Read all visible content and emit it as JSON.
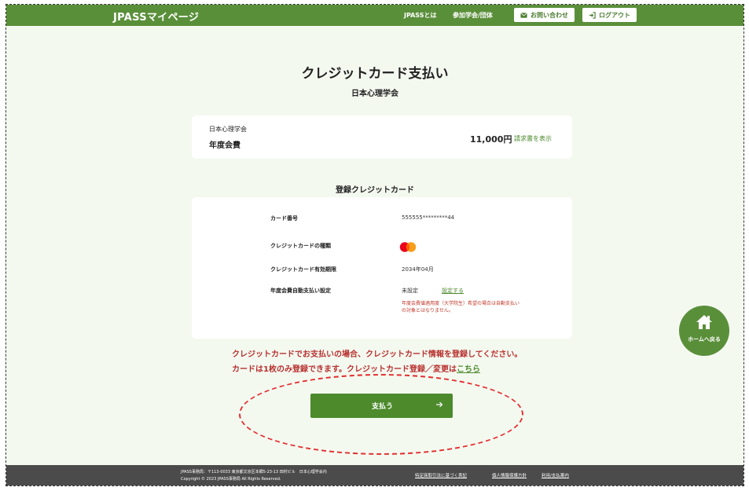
{
  "header": {
    "brand": "JPASSマイページ",
    "nav": {
      "about": "JPASSとは",
      "groups": "参加学会/団体",
      "contact": "お問い合わせ",
      "logout": "ログアウト"
    }
  },
  "main": {
    "title": "クレジットカード支払い",
    "organization": "日本心理学会",
    "fee": {
      "org": "日本心理学会",
      "name": "年度会費",
      "amount": "11,000円",
      "invoice_link": "請求書を表示"
    },
    "registered_card": {
      "section_title": "登録クレジットカード",
      "rows": [
        {
          "label": "カード番号",
          "value": "555555*********44"
        },
        {
          "label": "クレジットカードの種類",
          "value": ""
        },
        {
          "label": "クレジットカード有効期限",
          "value": "2034年04月"
        },
        {
          "label": "年度会費自動支払い設定",
          "value": "未設定"
        }
      ],
      "setting_link": "設定する",
      "note_line1": "年度会費値適用度（大学院生）希望の場合は自動支払い",
      "note_line2": "の対象とはなりません。",
      "brand_icon": "mastercard-icon"
    },
    "notice_line1": "クレジットカードでお支払いの場合、クレジットカード情報を登録してください。",
    "notice_line2_prefix": "カードは1枚のみ登録できます。クレジットカード登録／変更は",
    "notice_line2_link": "こちら",
    "pay_button": "支払う"
  },
  "home_button": "ホームへ戻る",
  "footer": {
    "address": "JPASS事務局：〒113-0033 東京都文京区本郷5-23-13 田村ビル　日本心理学会内",
    "copyright": "Copyright © 2023 JPASS事務局 All Rights Reserved.",
    "links": [
      "特定商取引法に基づく表記",
      "個人情報保護方針",
      "利用/支払案内"
    ]
  },
  "colors": {
    "primary": "#5a8f3a",
    "accent_red": "#b8312f",
    "background": "#f4f9f0",
    "footer": "#4b4b4b"
  }
}
